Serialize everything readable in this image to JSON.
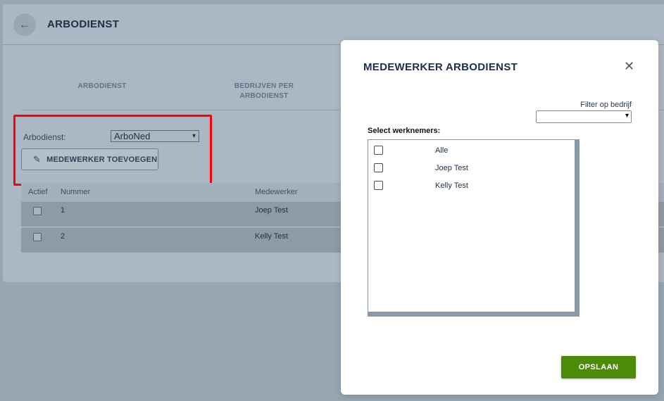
{
  "page": {
    "title": "ARBODIENST",
    "back_icon": "←",
    "tabs": [
      {
        "label": "ARBODIENST"
      },
      {
        "label": "BEDRIJVEN PER ARBODIENST"
      }
    ],
    "filter": {
      "label": "Arbodienst:",
      "selected": "ArboNed",
      "chevron": "▾"
    },
    "add_button": {
      "label": "MEDEWERKER TOEVOEGEN",
      "icon": "✎"
    },
    "highlight_color": "#ff0000",
    "table": {
      "headers": [
        "Actief",
        "Nummer",
        "Medewerker"
      ],
      "rows": [
        {
          "nummer": "1",
          "medewerker": "Joep Test",
          "actief": false
        },
        {
          "nummer": "2",
          "medewerker": "Kelly Test",
          "actief": false
        }
      ]
    }
  },
  "modal": {
    "title": "MEDEWERKER ARBODIENST",
    "close": "✕",
    "filter_label": "Filter op bedrijf",
    "filter_selected": "",
    "filter_chevron": "▾",
    "select_label": "Select werknemers:",
    "items": [
      {
        "label": "Alle",
        "checked": false
      },
      {
        "label": "Joep Test",
        "checked": false
      },
      {
        "label": "Kelly Test",
        "checked": false
      }
    ],
    "save_label": "OPSLAAN",
    "save_color": "#4c8a0a"
  }
}
